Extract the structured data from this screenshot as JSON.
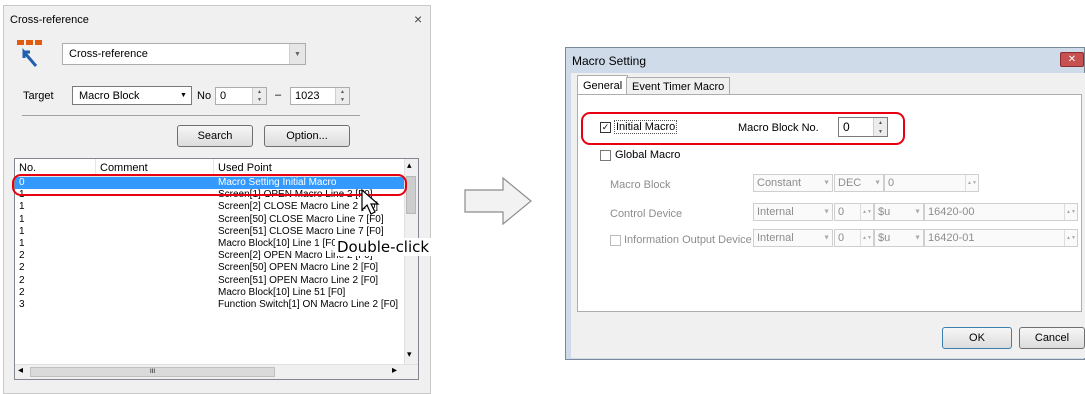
{
  "cross_reference": {
    "title": "Cross-reference",
    "close_label": "×",
    "source_combo": "Cross-reference",
    "target_label": "Target",
    "target_value": "Macro Block",
    "no_label": "No",
    "from_value": "0",
    "range_dash": "–",
    "to_value": "1023",
    "search_button": "Search",
    "option_button": "Option...",
    "columns": [
      "No.",
      "Comment",
      "Used Point"
    ],
    "rows": [
      {
        "no": "0",
        "comment": "",
        "used": "Macro Setting Initial Macro",
        "selected": true
      },
      {
        "no": "1",
        "comment": "",
        "used": "Screen[1] OPEN Macro Line 2 [F0]"
      },
      {
        "no": "1",
        "comment": "",
        "used": "Screen[2] CLOSE Macro Line 2 [F0]"
      },
      {
        "no": "1",
        "comment": "",
        "used": "Screen[50] CLOSE Macro Line 7 [F0]"
      },
      {
        "no": "1",
        "comment": "",
        "used": "Screen[51] CLOSE Macro Line 7 [F0]"
      },
      {
        "no": "1",
        "comment": "",
        "used": "Macro Block[10] Line 1 [F0]"
      },
      {
        "no": "2",
        "comment": "",
        "used": "Screen[2] OPEN Macro Line 2 [F0]"
      },
      {
        "no": "2",
        "comment": "",
        "used": "Screen[50] OPEN Macro Line 2 [F0]"
      },
      {
        "no": "2",
        "comment": "",
        "used": "Screen[51] OPEN Macro Line 2 [F0]"
      },
      {
        "no": "2",
        "comment": "",
        "used": "Macro Block[10] Line 51 [F0]"
      },
      {
        "no": "3",
        "comment": "",
        "used": "Function Switch[1] ON Macro Line 2 [F0]"
      }
    ],
    "scroll_left": "◂",
    "scroll_right": "▸",
    "scroll_thumb": "III",
    "scroll_up": "▴",
    "scroll_down": "▾"
  },
  "callout": "Double-click",
  "macro_setting": {
    "title": "Macro Setting",
    "close_label": "✕",
    "tabs": [
      "General",
      "Event Timer Macro"
    ],
    "initial_macro_label": "Initial Macro",
    "initial_macro_checked": true,
    "macro_block_no_label": "Macro Block No.",
    "macro_block_no_value": "0",
    "global_macro_label": "Global Macro",
    "macro_block_label": "Macro Block",
    "macro_block_type": "Constant",
    "macro_block_format": "DEC",
    "macro_block_value": "0",
    "control_device_label": "Control Device",
    "control_device_source": "Internal",
    "control_device_port": "0",
    "control_device_type": "$u",
    "control_device_addr": "16420-00",
    "info_output_label": "Information Output Device",
    "info_output_source": "Internal",
    "info_output_port": "0",
    "info_output_type": "$u",
    "info_output_addr": "16420-01",
    "ok_button": "OK",
    "cancel_button": "Cancel"
  },
  "colors": {
    "highlight": "#e60012",
    "selection": "#3399ff"
  }
}
